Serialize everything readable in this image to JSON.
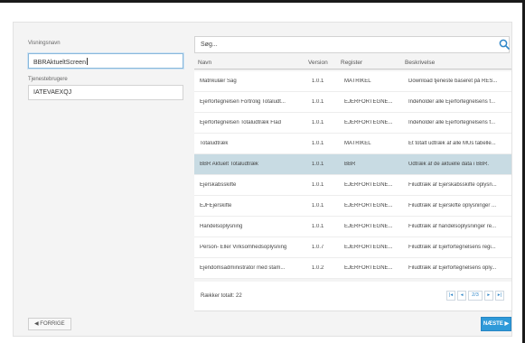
{
  "form": {
    "visningsnavn_label": "Visningsnavn",
    "visningsnavn_value": "BBRAktueltScreen",
    "tjenestebrugere_label": "Tjenestebrugere",
    "tjenestebrugere_value": "IATEVAEXQJ"
  },
  "search": {
    "placeholder": "Søg..."
  },
  "table": {
    "columns": {
      "navn": "Navn",
      "version": "Version",
      "register": "Register",
      "beskrivelse": "Beskrivelse"
    },
    "rows": [
      {
        "navn": "Matrikulær Sag",
        "version": "1.0.1",
        "register": "MATRIKEL",
        "beskrivelse": "Download tjeneste baseret på RES..."
      },
      {
        "navn": "Ejerfortegnelsen Fortrolig Totaludt...",
        "version": "1.0.1",
        "register": "EJERFORTEGNE...",
        "beskrivelse": "Indeholder alle Ejerfortegnelsens f..."
      },
      {
        "navn": "Ejerfortegnelsen Totaludtræk Flad",
        "version": "1.0.1",
        "register": "EJERFORTEGNE...",
        "beskrivelse": "Indeholder alle Ejerfortegnelsens f..."
      },
      {
        "navn": "Totaludtræk",
        "version": "1.0.1",
        "register": "MATRIKEL",
        "beskrivelse": "Et totalt udtræk af alle MUs tabelle..."
      },
      {
        "navn": "BBR Aktuelt Totaludtræk",
        "version": "1.0.1",
        "register": "BBR",
        "beskrivelse": "Udtræk af de aktuelle data i BBR."
      },
      {
        "navn": "Ejerskabsskifte",
        "version": "1.0.1",
        "register": "EJERFORTEGNE...",
        "beskrivelse": "Filudtræk af Ejerskabsskifte oplysn..."
      },
      {
        "navn": "EJFEjerskifte",
        "version": "1.0.1",
        "register": "EJERFORTEGNE...",
        "beskrivelse": "Filudtræk af Ejerskifte oplysninger ..."
      },
      {
        "navn": "Handelsoplysning",
        "version": "1.0.1",
        "register": "EJERFORTEGNE...",
        "beskrivelse": "Filudtræk af handelsoplysninger re..."
      },
      {
        "navn": "Person- Eller Virksomhedsoplysning",
        "version": "1.0.7",
        "register": "EJERFORTEGNE...",
        "beskrivelse": "Filudtræk af Ejerfortegnelsens regi..."
      },
      {
        "navn": "Ejendomsadministrator med stam...",
        "version": "1.0.2",
        "register": "EJERFORTEGNE...",
        "beskrivelse": "Filudtræk af Ejerfortegnelsens oply..."
      }
    ],
    "selected_index": 4,
    "total_label": "Rækker totalt: 22",
    "pager": {
      "first": "|◂",
      "prev": "◂",
      "info": "2/3",
      "next": "▸",
      "last": "▸|"
    }
  },
  "buttons": {
    "prev": "◀ FORRIGE",
    "next": "NÆSTE ▶"
  },
  "colors": {
    "accent": "#2f9ad9",
    "selected_row": "#c8dbe3"
  }
}
